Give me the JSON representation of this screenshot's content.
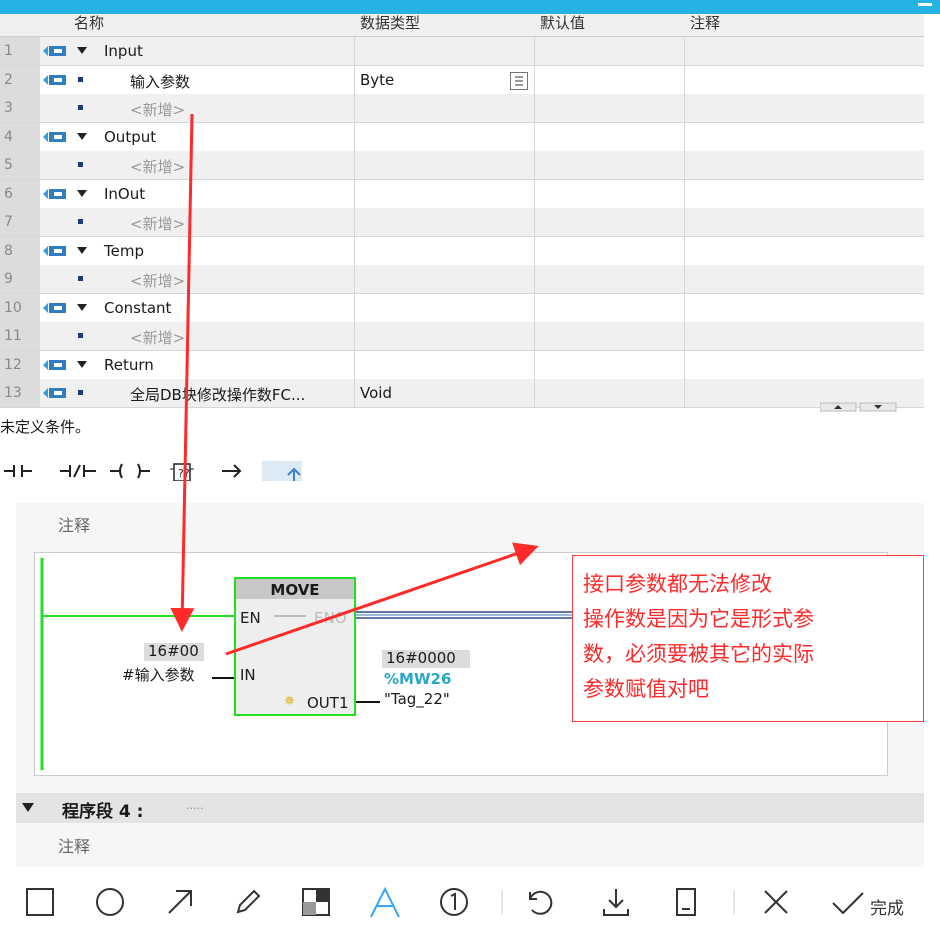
{
  "table": {
    "headers": [
      "名称",
      "数据类型",
      "默认值",
      "注释"
    ],
    "rows": [
      {
        "num": "1",
        "name": "Input",
        "kind": "section",
        "dtype": ""
      },
      {
        "num": "2",
        "name": "输入参数",
        "kind": "item",
        "dtype": "Byte"
      },
      {
        "num": "3",
        "name": "<新增>",
        "kind": "add",
        "dtype": ""
      },
      {
        "num": "4",
        "name": "Output",
        "kind": "section",
        "dtype": ""
      },
      {
        "num": "5",
        "name": "<新增>",
        "kind": "add",
        "dtype": ""
      },
      {
        "num": "6",
        "name": "InOut",
        "kind": "section",
        "dtype": ""
      },
      {
        "num": "7",
        "name": "<新增>",
        "kind": "add",
        "dtype": ""
      },
      {
        "num": "8",
        "name": "Temp",
        "kind": "section",
        "dtype": ""
      },
      {
        "num": "9",
        "name": "<新增>",
        "kind": "add",
        "dtype": ""
      },
      {
        "num": "10",
        "name": "Constant",
        "kind": "section",
        "dtype": ""
      },
      {
        "num": "11",
        "name": "<新增>",
        "kind": "add",
        "dtype": ""
      },
      {
        "num": "12",
        "name": "Return",
        "kind": "section",
        "dtype": ""
      },
      {
        "num": "13",
        "name": "全局DB块修改操作数FC...",
        "kind": "item",
        "dtype": "Void"
      }
    ]
  },
  "condition_text": "未定义条件。",
  "network": {
    "comment": "注释",
    "block": {
      "title": "MOVE",
      "en": "EN",
      "eno": "ENO",
      "in": "IN",
      "out1": "OUT1",
      "in_value": "16#00",
      "in_param": "#输入参数",
      "out_value": "16#0000",
      "out_addr": "%MW26",
      "out_tag": "\"Tag_22\""
    }
  },
  "segment4": {
    "title": "程序段 4 :",
    "dots": ".....",
    "comment": "注释"
  },
  "annotation": {
    "lines": [
      "接口参数都无法修改",
      "操作数是因为它是形式参",
      "数，必须要被其它的实际",
      "参数赋值对吧"
    ]
  },
  "bottom_toolbar": {
    "done_label": "完成"
  },
  "colors": {
    "accent": "#26b3e4",
    "annotation_red": "#ff2a2a",
    "ladder_green": "#22dd22"
  }
}
